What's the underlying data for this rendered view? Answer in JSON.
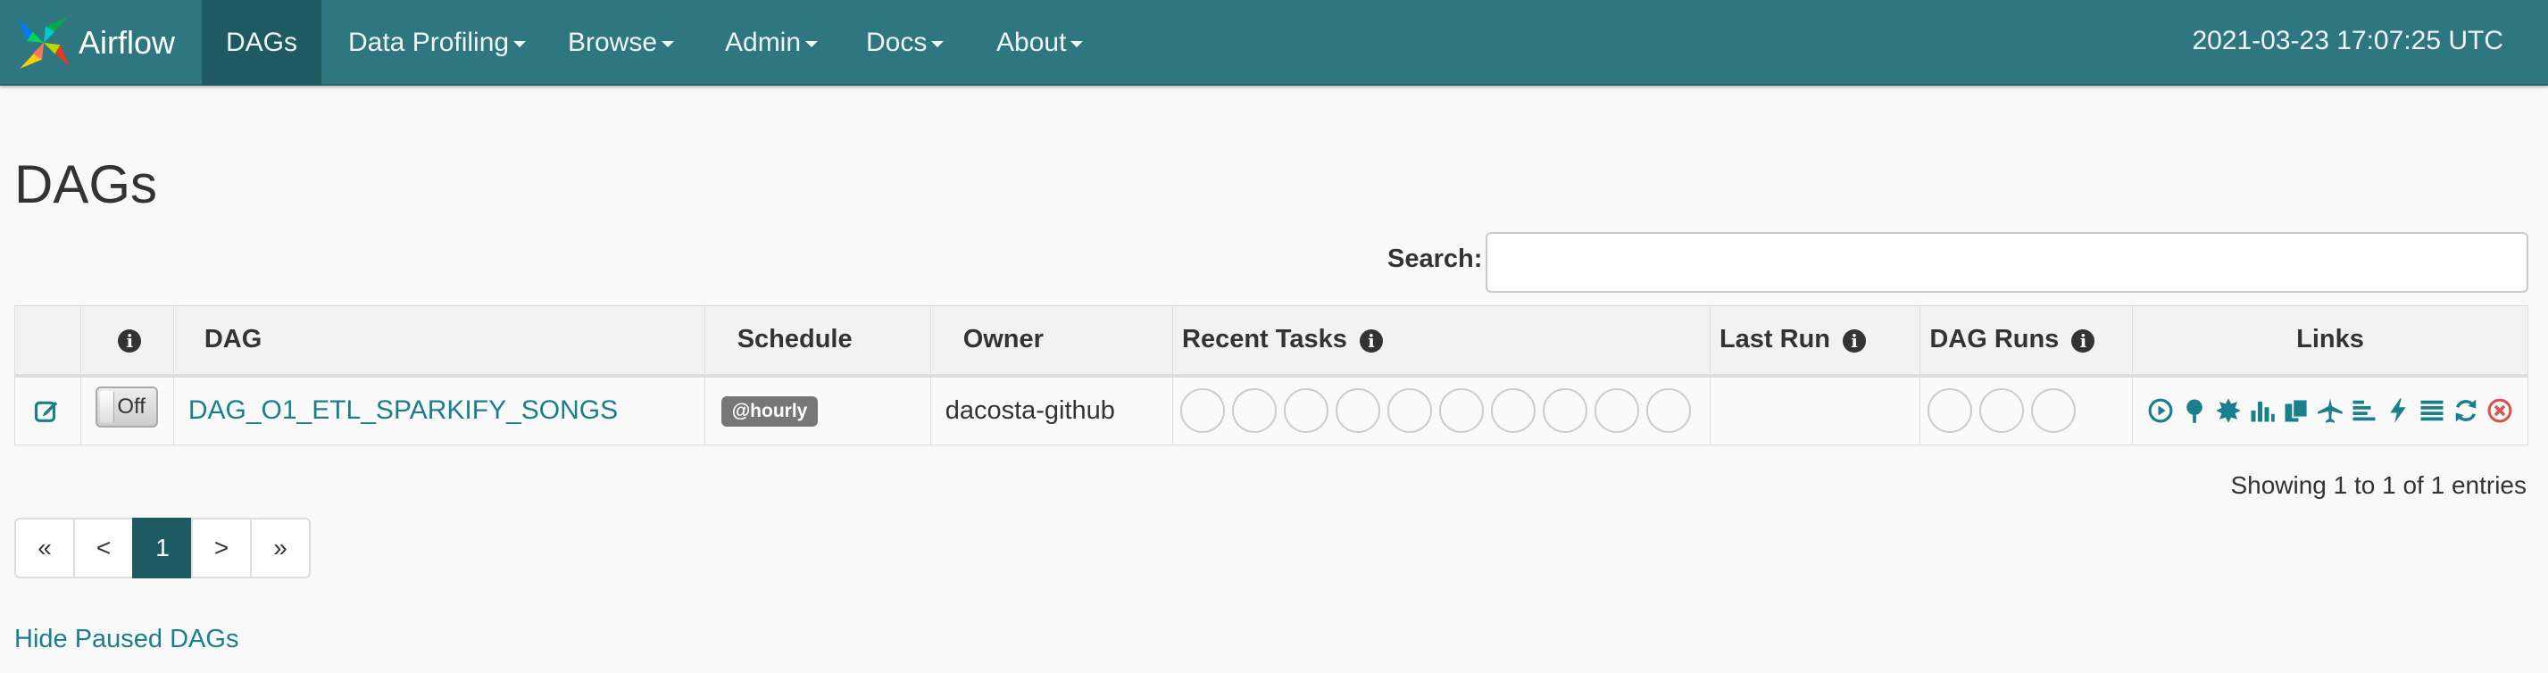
{
  "navbar": {
    "brand": "Airflow",
    "items": [
      {
        "label": "DAGs",
        "dropdown": false,
        "active": true
      },
      {
        "label": "Data Profiling",
        "dropdown": true
      },
      {
        "label": "Browse",
        "dropdown": true
      },
      {
        "label": "Admin",
        "dropdown": true
      },
      {
        "label": "Docs",
        "dropdown": true
      },
      {
        "label": "About",
        "dropdown": true
      }
    ],
    "clock": "2021-03-23 17:07:25 UTC"
  },
  "page": {
    "title": "DAGs",
    "search_label": "Search:",
    "search_value": ""
  },
  "table": {
    "headers": {
      "info": "i",
      "dag": "DAG",
      "schedule": "Schedule",
      "owner": "Owner",
      "recent_tasks": "Recent Tasks",
      "last_run": "Last Run",
      "dag_runs": "DAG Runs",
      "links": "Links"
    },
    "rows": [
      {
        "toggle": "Off",
        "dag_id": "DAG_O1_ETL_SPARKIFY_SONGS",
        "schedule": "@hourly",
        "owner": "dacosta-github",
        "last_run": "",
        "recent_task_circles": 10,
        "dag_run_circles": 3
      }
    ],
    "link_icons": [
      "trigger-dag-icon",
      "tree-view-icon",
      "graph-view-icon",
      "duration-chart-icon",
      "task-tries-icon",
      "landing-times-icon",
      "gantt-icon",
      "code-icon",
      "logs-icon",
      "refresh-icon",
      "delete-icon"
    ],
    "link_color": "#1a7f8c",
    "delete_color": "#d9534f"
  },
  "footer": {
    "showing": "Showing 1 to 1 of 1 entries",
    "pagination": [
      "«",
      "<",
      "1",
      ">",
      "»"
    ],
    "active_page": "1",
    "hide_paused": "Hide Paused DAGs"
  }
}
